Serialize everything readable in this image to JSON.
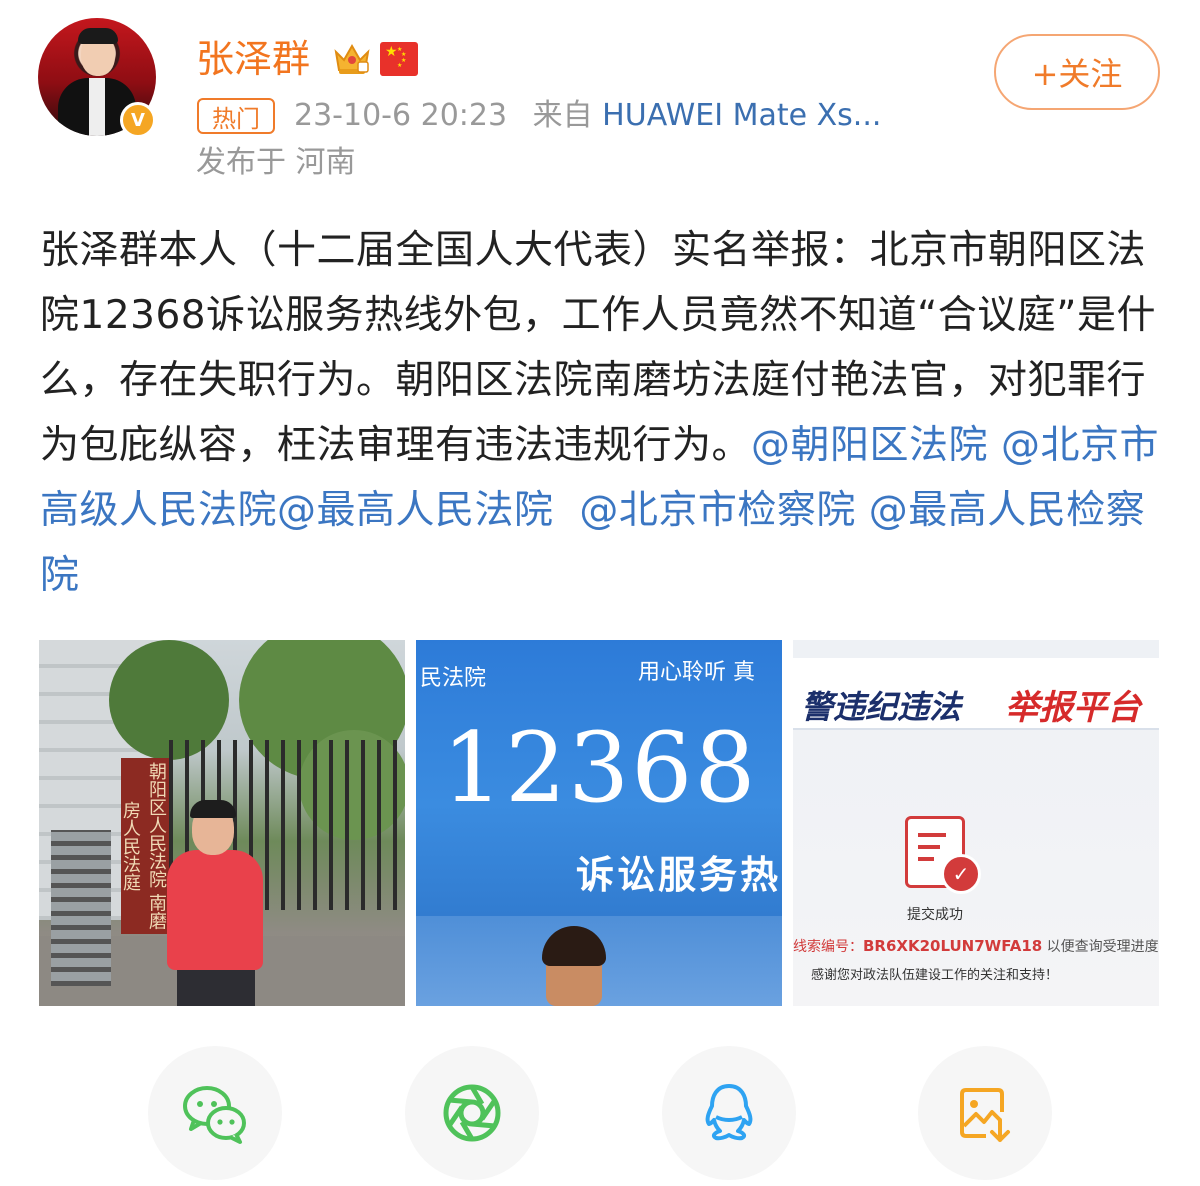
{
  "user": {
    "name": "张泽群",
    "hot_label": "热门",
    "timestamp": "23-10-6 20:23",
    "source_prefix": "来自",
    "source_device": "HUAWEI Mate Xs...",
    "location": "发布于 河南",
    "follow_label": "+关注",
    "verified_mark": "V"
  },
  "post": {
    "text": "张泽群本人（十二届全国人大代表）实名举报：北京市朝阳区法院12368诉讼服务热线外包，工作人员竟然不知道“合议庭”是什么，存在失职行为。朝阳区法院南磨坊法庭付艳法官，对犯罪行为包庇纵容，枉法审理有违法违规行为。",
    "mentions": [
      "@朝阳区法院",
      "@北京市高级人民法院",
      "@最高人民法院",
      "@北京市检察院",
      "@最高人民检察院"
    ]
  },
  "images": {
    "img1": {
      "sign_text": "朝阳区人民法院 南磨房人民法庭"
    },
    "img2": {
      "top_left": "民法院",
      "top_right": "用心聆听 真",
      "number": "12368",
      "subtitle": "诉讼服务热"
    },
    "img3": {
      "title_left": "警违纪违法",
      "title_right": "举报平台",
      "status": "提交成功",
      "code_label": "线索编号：",
      "code": "BR6XK20LUN7WFA18",
      "code_suffix": " 以便查询受理进度。",
      "thanks": "感谢您对政法队伍建设工作的关注和支持！"
    }
  },
  "share": {
    "icons": [
      "wechat-icon",
      "moments-icon",
      "qq-icon",
      "save-image-icon"
    ]
  },
  "colors": {
    "username": "#f2751f",
    "mention": "#3b76c2",
    "wechat": "#4fc25a",
    "qq": "#2ea3f2",
    "save": "#f5a623"
  }
}
